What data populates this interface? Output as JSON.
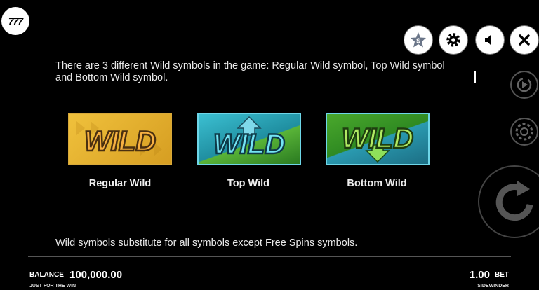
{
  "logo": {
    "text": "777"
  },
  "top_buttons": [
    {
      "name": "special-offer-button",
      "icon": "star-dollar-icon",
      "symbol": "$"
    },
    {
      "name": "settings-button",
      "icon": "gear-icon"
    },
    {
      "name": "sound-button",
      "icon": "speaker-icon"
    },
    {
      "name": "close-button",
      "icon": "close-icon"
    }
  ],
  "info": {
    "intro": "There are 3 different Wild symbols in the game: Regular Wild symbol, Top Wild symbol and Bottom Wild symbol.",
    "footer": "Wild symbols substitute for all symbols except Free Spins symbols."
  },
  "wild_cards": [
    {
      "label": "Regular Wild",
      "symbol_text": "WILD",
      "bg": "#e8b62c",
      "text_color": "#f5a83a"
    },
    {
      "label": "Top Wild",
      "symbol_text": "WILD",
      "bg": "#2a9aa8",
      "text_color": "#6ee2f2"
    },
    {
      "label": "Bottom Wild",
      "symbol_text": "WILD",
      "bg": "#3a9a28",
      "text_color": "#a8e85a"
    }
  ],
  "side_controls": [
    {
      "name": "autoplay-button",
      "icon": "autoplay-icon"
    },
    {
      "name": "bet-chip-button",
      "icon": "chip-icon"
    },
    {
      "name": "spin-button",
      "icon": "spin-arrow-icon"
    }
  ],
  "bottom_bar": {
    "balance_label": "BALANCE",
    "balance_value": "100,000.00",
    "bet_value": "1.00",
    "bet_label": "BET",
    "provider": "JUST FOR THE WIN",
    "game_name": "SIDEWINDER"
  },
  "colors": {
    "background": "#000000",
    "card_border": "#6ed6e8"
  }
}
